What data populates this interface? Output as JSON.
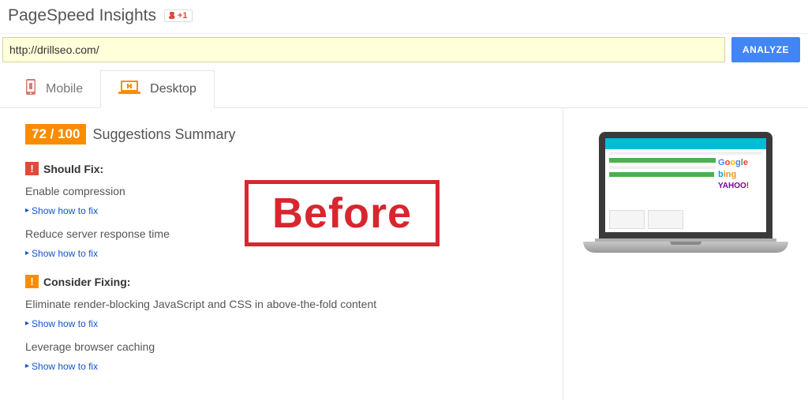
{
  "header": {
    "title": "PageSpeed Insights",
    "gplus_label": "+1"
  },
  "url_bar": {
    "value": "http://drillseo.com/",
    "analyze_label": "ANALYZE"
  },
  "tabs": {
    "mobile": "Mobile",
    "desktop": "Desktop",
    "active": "desktop"
  },
  "score": {
    "display": "72 / 100",
    "summary_title": "Suggestions Summary"
  },
  "should_fix": {
    "title": "Should Fix:",
    "items": [
      {
        "text": "Enable compression",
        "link": "Show how to fix"
      },
      {
        "text": "Reduce server response time",
        "link": "Show how to fix"
      }
    ]
  },
  "consider_fixing": {
    "title": "Consider Fixing:",
    "items": [
      {
        "text": "Eliminate render-blocking JavaScript and CSS in above-the-fold content",
        "link": "Show how to fix"
      },
      {
        "text": "Leverage browser caching",
        "link": "Show how to fix"
      }
    ]
  },
  "overlay": {
    "stamp": "Before"
  },
  "preview": {
    "logos": {
      "google": "Google",
      "bing": "bing",
      "yahoo": "YAHOO!"
    }
  }
}
